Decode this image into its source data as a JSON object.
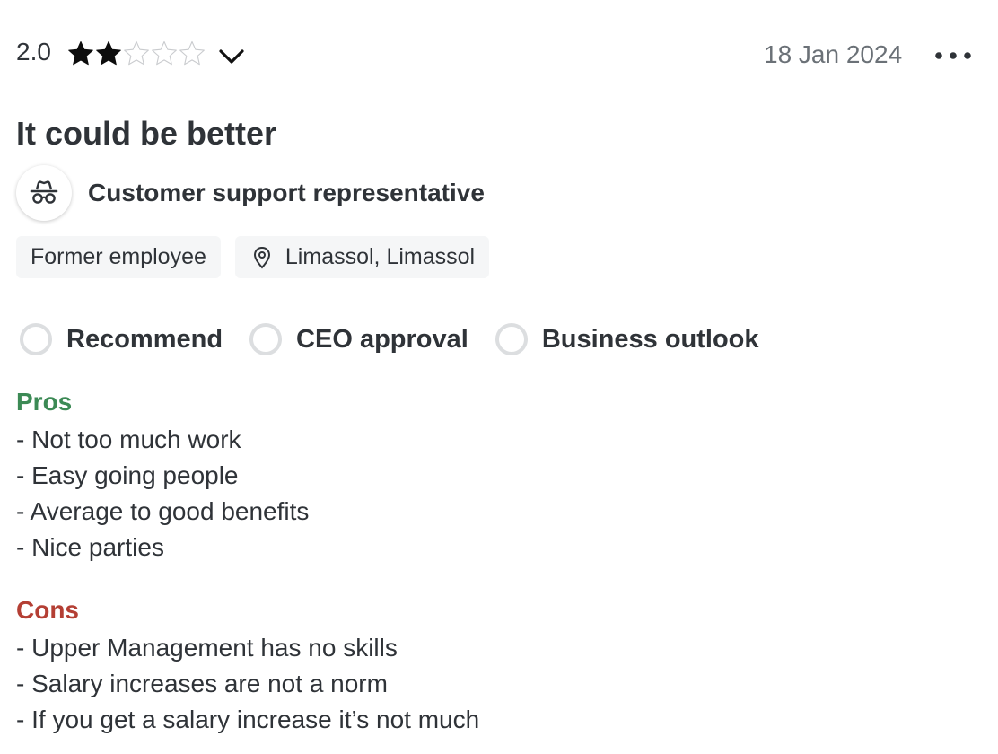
{
  "review": {
    "rating_value": "2.0",
    "rating_stars": 2,
    "rating_max": 5,
    "date": "18 Jan 2024",
    "title": "It could be better",
    "role": "Customer support representative",
    "role_icon": "incognito-icon",
    "tags": {
      "employment_status": "Former employee",
      "location": "Limassol, Limassol"
    },
    "ratings": {
      "recommend": "Recommend",
      "ceo_approval": "CEO approval",
      "business_outlook": "Business outlook"
    },
    "pros": {
      "heading": "Pros",
      "lines": [
        "- Not too much work",
        "- Easy going people",
        "- Average to good benefits",
        "- Nice parties"
      ]
    },
    "cons": {
      "heading": "Cons",
      "lines": [
        "- Upper Management has no skills",
        "- Salary increases are not a norm",
        "- If you get a salary increase it’s not much"
      ]
    }
  },
  "colors": {
    "text": "#2f3338",
    "muted": "#6b7177",
    "pros": "#3c8a55",
    "cons": "#b43f34",
    "tag_bg": "#f5f6f7",
    "circle_border": "#dcdee0"
  }
}
